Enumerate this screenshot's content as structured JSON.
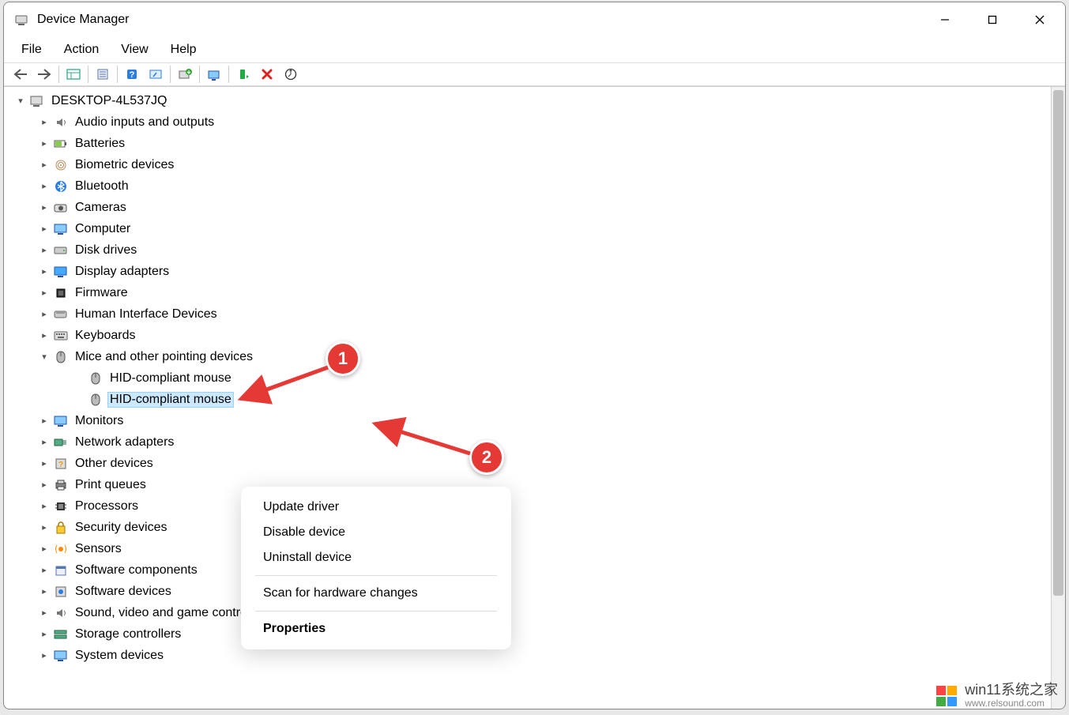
{
  "window": {
    "title": "Device Manager"
  },
  "menu": {
    "items": [
      "File",
      "Action",
      "View",
      "Help"
    ]
  },
  "tree": {
    "root": "DESKTOP-4L537JQ",
    "nodes": [
      {
        "label": "Audio inputs and outputs",
        "icon": "audio"
      },
      {
        "label": "Batteries",
        "icon": "battery"
      },
      {
        "label": "Biometric devices",
        "icon": "biometric"
      },
      {
        "label": "Bluetooth",
        "icon": "bluetooth"
      },
      {
        "label": "Cameras",
        "icon": "camera"
      },
      {
        "label": "Computer",
        "icon": "computer"
      },
      {
        "label": "Disk drives",
        "icon": "disk"
      },
      {
        "label": "Display adapters",
        "icon": "display"
      },
      {
        "label": "Firmware",
        "icon": "firmware"
      },
      {
        "label": "Human Interface Devices",
        "icon": "hid"
      },
      {
        "label": "Keyboards",
        "icon": "keyboard"
      },
      {
        "label": "Mice and other pointing devices",
        "icon": "mouse",
        "expanded": true,
        "children": [
          {
            "label": "HID-compliant mouse",
            "icon": "mouse",
            "selected": false
          },
          {
            "label": "HID-compliant mouse",
            "icon": "mouse",
            "selected": true
          }
        ]
      },
      {
        "label": "Monitors",
        "icon": "monitor"
      },
      {
        "label": "Network adapters",
        "icon": "network"
      },
      {
        "label": "Other devices",
        "icon": "other"
      },
      {
        "label": "Print queues",
        "icon": "printer"
      },
      {
        "label": "Processors",
        "icon": "cpu"
      },
      {
        "label": "Security devices",
        "icon": "security"
      },
      {
        "label": "Sensors",
        "icon": "sensor"
      },
      {
        "label": "Software components",
        "icon": "sw-comp"
      },
      {
        "label": "Software devices",
        "icon": "sw-dev"
      },
      {
        "label": "Sound, video and game controllers",
        "icon": "sound"
      },
      {
        "label": "Storage controllers",
        "icon": "storage"
      },
      {
        "label": "System devices",
        "icon": "system"
      }
    ]
  },
  "context_menu": {
    "items": [
      {
        "label": "Update driver"
      },
      {
        "label": "Disable device"
      },
      {
        "label": "Uninstall device"
      },
      {
        "sep": true
      },
      {
        "label": "Scan for hardware changes"
      },
      {
        "sep": true
      },
      {
        "label": "Properties",
        "bold": true
      }
    ]
  },
  "annotations": {
    "badge1": "1",
    "badge2": "2"
  },
  "watermark": {
    "line1": "win11系统之家",
    "line2": "www.relsound.com"
  }
}
